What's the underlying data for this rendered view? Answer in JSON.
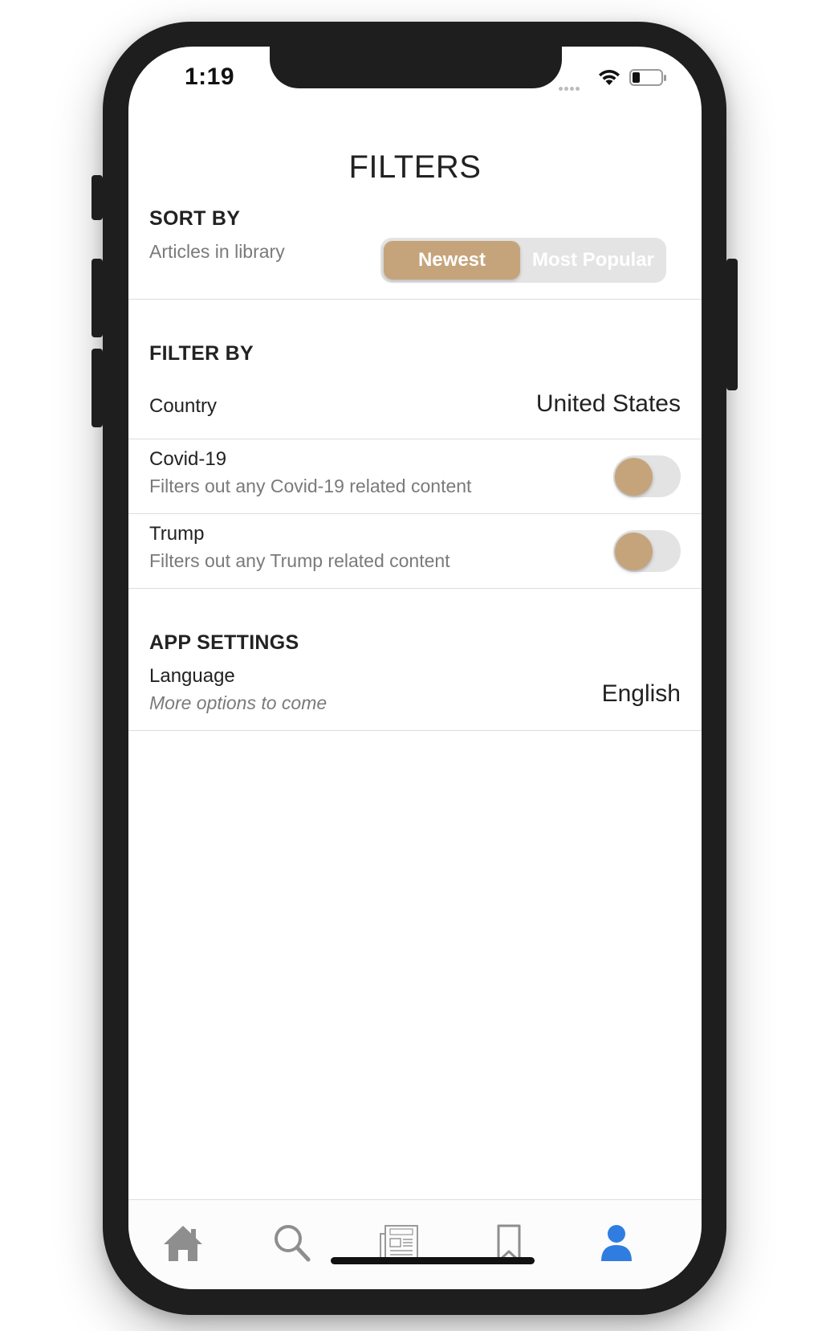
{
  "status_bar": {
    "time": "1:19"
  },
  "page": {
    "title": "FILTERS"
  },
  "sort_by": {
    "header": "SORT BY",
    "subtitle": "Articles in library",
    "options": [
      "Newest",
      "Most Popular"
    ],
    "selected": "Newest"
  },
  "filter_by": {
    "header": "FILTER BY",
    "country": {
      "label": "Country",
      "value": "United States"
    },
    "toggles": [
      {
        "label": "Covid-19",
        "description": "Filters out any Covid-19 related content",
        "on": false
      },
      {
        "label": "Trump",
        "description": "Filters out any Trump related content",
        "on": false
      }
    ]
  },
  "app_settings": {
    "header": "APP SETTINGS",
    "language": {
      "label": "Language",
      "note": "More options to come",
      "value": "English"
    }
  },
  "tab_bar": {
    "items": [
      {
        "icon": "home-icon",
        "active": false
      },
      {
        "icon": "search-icon",
        "active": false
      },
      {
        "icon": "news-icon",
        "active": false
      },
      {
        "icon": "bookmark-icon",
        "active": false
      },
      {
        "icon": "profile-icon",
        "active": true
      }
    ]
  },
  "colors": {
    "accent": "#c6a47b",
    "active_tab": "#2f7de1",
    "inactive_tab": "#8e8e8e",
    "segment_bg": "#e4e4e4",
    "toggle_track": "#e3e3e3"
  }
}
